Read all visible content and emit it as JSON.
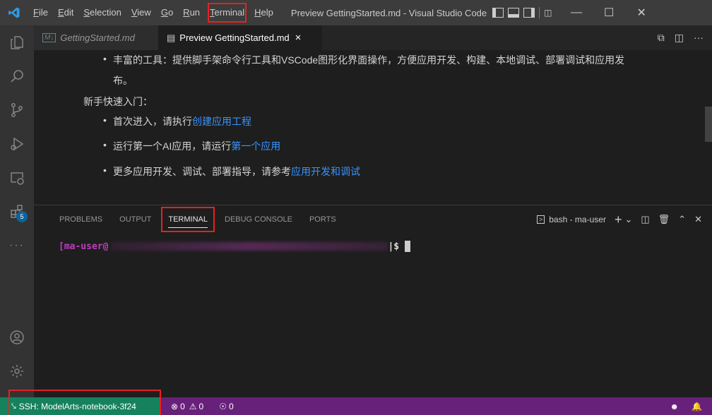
{
  "titlebar": {
    "menus": [
      {
        "label": "File",
        "key": "F"
      },
      {
        "label": "Edit",
        "key": "E"
      },
      {
        "label": "Selection",
        "key": "S"
      },
      {
        "label": "View",
        "key": "V"
      },
      {
        "label": "Go",
        "key": "G"
      },
      {
        "label": "Run",
        "key": "R"
      },
      {
        "label": "Terminal",
        "key": "T"
      },
      {
        "label": "Help",
        "key": "H"
      }
    ],
    "window_title": "Preview GettingStarted.md - Visual Studio Code",
    "icons": [
      "vscode-logo-icon",
      "toggle-sidebar-icon",
      "toggle-panel-icon",
      "toggle-secondary-sidebar-icon",
      "customize-layout-icon",
      "minimize-icon",
      "maximize-icon",
      "close-icon"
    ]
  },
  "activitybar": {
    "icons": [
      "explorer-icon",
      "search-icon",
      "source-control-icon",
      "run-debug-icon",
      "remote-explorer-icon",
      "extensions-icon",
      "more-icon",
      "accounts-icon",
      "settings-gear-icon"
    ],
    "extensions_badge": "5"
  },
  "tabs": [
    {
      "label": "GettingStarted.md",
      "icon": "markdown-icon",
      "active": false
    },
    {
      "label": "Preview GettingStarted.md",
      "icon": "preview-icon",
      "active": true,
      "close": "×"
    }
  ],
  "preview": {
    "bullet_top_line1": "丰富的工具：提供脚手架命令行工具和VSCode图形化界面操作，方便应用开发、构建、本地调试、部署调试和应用发",
    "bullet_top_line2": "布。",
    "heading": "新手快速入门：",
    "items": [
      {
        "text": "首次进入，请执行",
        "link": "创建应用工程"
      },
      {
        "text": "运行第一个AI应用，请运行",
        "link": "第一个应用"
      },
      {
        "text": "更多应用开发、调试、部署指导，请参考",
        "link": "应用开发和调试"
      }
    ]
  },
  "panel": {
    "tabs": [
      "PROBLEMS",
      "OUTPUT",
      "TERMINAL",
      "DEBUG CONSOLE",
      "PORTS"
    ],
    "active_tab": "TERMINAL",
    "terminal_name": "bash - ma-user",
    "terminal_prompt_user": "[ma-user@",
    "terminal_prompt_end": "|$"
  },
  "statusbar": {
    "remote": "SSH: ModelArts-notebook-3f24",
    "errors": "0",
    "warnings": "0",
    "ports": "0"
  },
  "colors": {
    "statusbar": "#68217a",
    "remote": "#16825d",
    "link": "#3794ff",
    "highlight": "#e52222"
  }
}
